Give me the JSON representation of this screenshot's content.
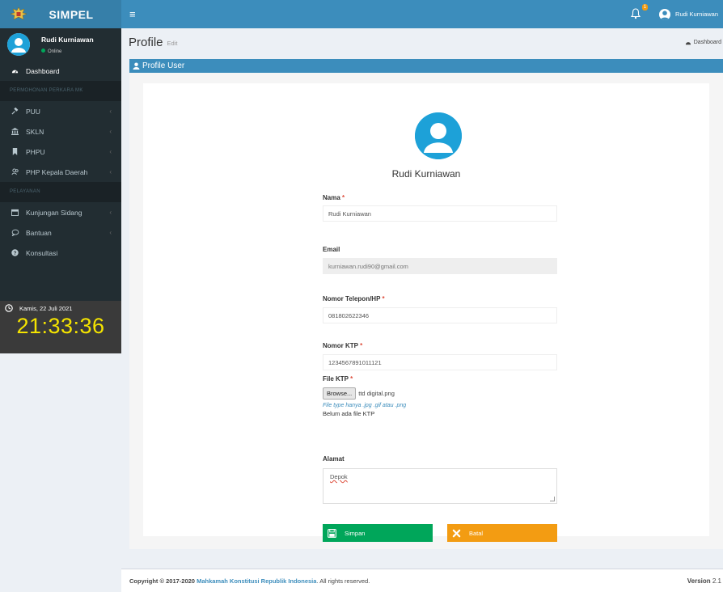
{
  "app": {
    "title": "SIMPEL"
  },
  "topbar": {
    "user_name": "Rudi Kurniawan",
    "notification_count": "1"
  },
  "sidebar": {
    "user_name": "Rudi Kurniawan",
    "user_status": "Online",
    "menu": [
      {
        "label": "Dashboard",
        "icon": "dashboard-icon"
      },
      {
        "header": "PERMOHONAN PERKARA MK"
      },
      {
        "label": "PUU",
        "icon": "gavel-icon"
      },
      {
        "label": "SKLN",
        "icon": "institution-icon"
      },
      {
        "label": "PHPU",
        "icon": "bookmark-icon"
      },
      {
        "label": "PHP Kepala Daerah",
        "icon": "users-icon"
      },
      {
        "header": "PELAYANAN"
      },
      {
        "label": "Kunjungan Sidang",
        "icon": "calendar-icon"
      },
      {
        "label": "Bantuan",
        "icon": "comment-icon"
      },
      {
        "label": "Konsultasi",
        "icon": "question-icon"
      }
    ],
    "clock": {
      "date": "Kamis, 22 Juli 2021",
      "time": "21:33:36"
    }
  },
  "content": {
    "title": "Profile",
    "subtitle": "Edit",
    "breadcrumb": "Dashboard"
  },
  "box": {
    "title": "Profile User"
  },
  "profile": {
    "name": "Rudi Kurniawan",
    "fields": {
      "nama_label": "Nama",
      "nama_value": "Rudi Kurniawan",
      "email_label": "Email",
      "email_value": "kurniawan.rudi90@gmail.com",
      "telepon_label": "Nomor Telepon/HP",
      "telepon_value": "081802622346",
      "ktp_label": "Nomor KTP",
      "ktp_value": "1234567891011121",
      "file_label": "File KTP",
      "browse_label": "Browse...",
      "file_name": "ttd digital.png",
      "file_hint": "File type hanya .jpg .gif atau .png",
      "file_note": "Belum ada file KTP",
      "alamat_label": "Alamat",
      "alamat_value": "Depok"
    },
    "buttons": {
      "save": "Simpan",
      "cancel": "Batal"
    }
  },
  "footer": {
    "copyright": "Copyright © 2017-2020",
    "org": "Mahkamah Konstitusi Republik Indonesia",
    "rights": ". All rights reserved.",
    "version_label": "Version",
    "version_value": "2.1"
  },
  "colors": {
    "primary": "#3c8dbc",
    "sidebar": "#222d32",
    "success": "#00a65a",
    "warning": "#f39c12",
    "clock": "#f5e400"
  }
}
